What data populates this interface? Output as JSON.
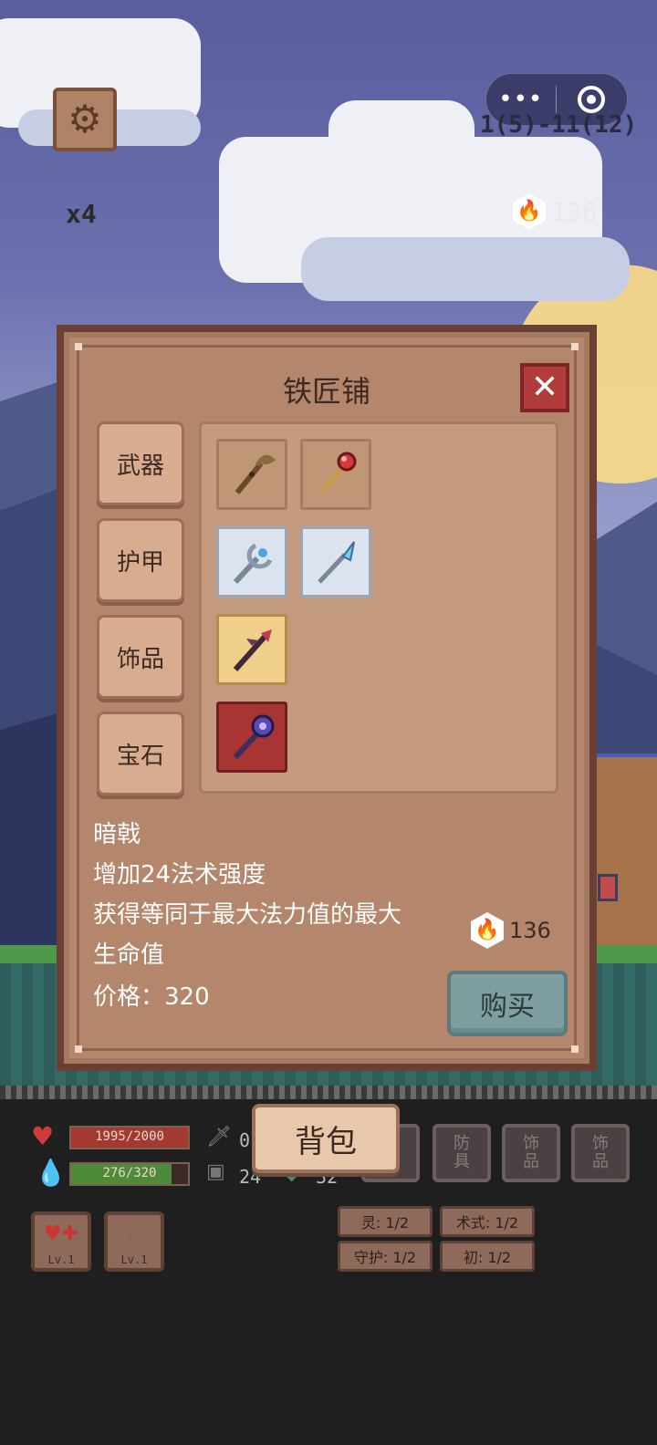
{
  "hud": {
    "speed": "x4",
    "stage": "1(5)-11(12)",
    "currency": "136",
    "capsule_more": "•••"
  },
  "shop": {
    "title": "铁匠铺",
    "close": "✕",
    "tabs": [
      "武器",
      "护甲",
      "饰品",
      "宝石"
    ],
    "items": [
      {
        "icon": "wooden-staff-icon",
        "rarity_color": "#bf9676"
      },
      {
        "icon": "red-orb-staff-icon",
        "rarity_color": "#bf9676"
      },
      {
        "icon": "crescent-staff-icon",
        "rarity_color": "#dbe4ee"
      },
      {
        "icon": "ice-spear-staff-icon",
        "rarity_color": "#dbe4ee"
      },
      {
        "icon": "dark-halberd-icon",
        "rarity_color": "#efcf8a"
      },
      {
        "icon": "void-staff-icon",
        "rarity_color": "#a83434"
      }
    ],
    "selected": {
      "name": "暗戟",
      "line1": "增加24法术强度",
      "line2": "获得等同于最大法力值的最大",
      "line3": "生命值",
      "price": "价格：320"
    },
    "wallet": "136",
    "buy": "购买"
  },
  "player": {
    "hp": "1995/2000",
    "hp_ratio": 0.9975,
    "mp": "276/320",
    "mp_ratio": 0.8625,
    "atk": "0",
    "def": "24",
    "other": "32",
    "bag": "背包",
    "equip": [
      {
        "line1": "防",
        "line2": "具"
      },
      {
        "line1": "饰",
        "line2": "品"
      },
      {
        "line1": "饰",
        "line2": "品"
      }
    ],
    "skills": [
      {
        "lv": "Lv.1"
      },
      {
        "lv": "Lv.1"
      }
    ],
    "tags": [
      "灵: 1/2",
      "术式: 1/2",
      "守护: 1/2",
      "初: 1/2"
    ]
  },
  "colors": {
    "hp_fill": "#a33a32",
    "mp_fill": "#4f8a3b",
    "panel": "#b4866c",
    "buy_button": "#7f9ea0"
  }
}
